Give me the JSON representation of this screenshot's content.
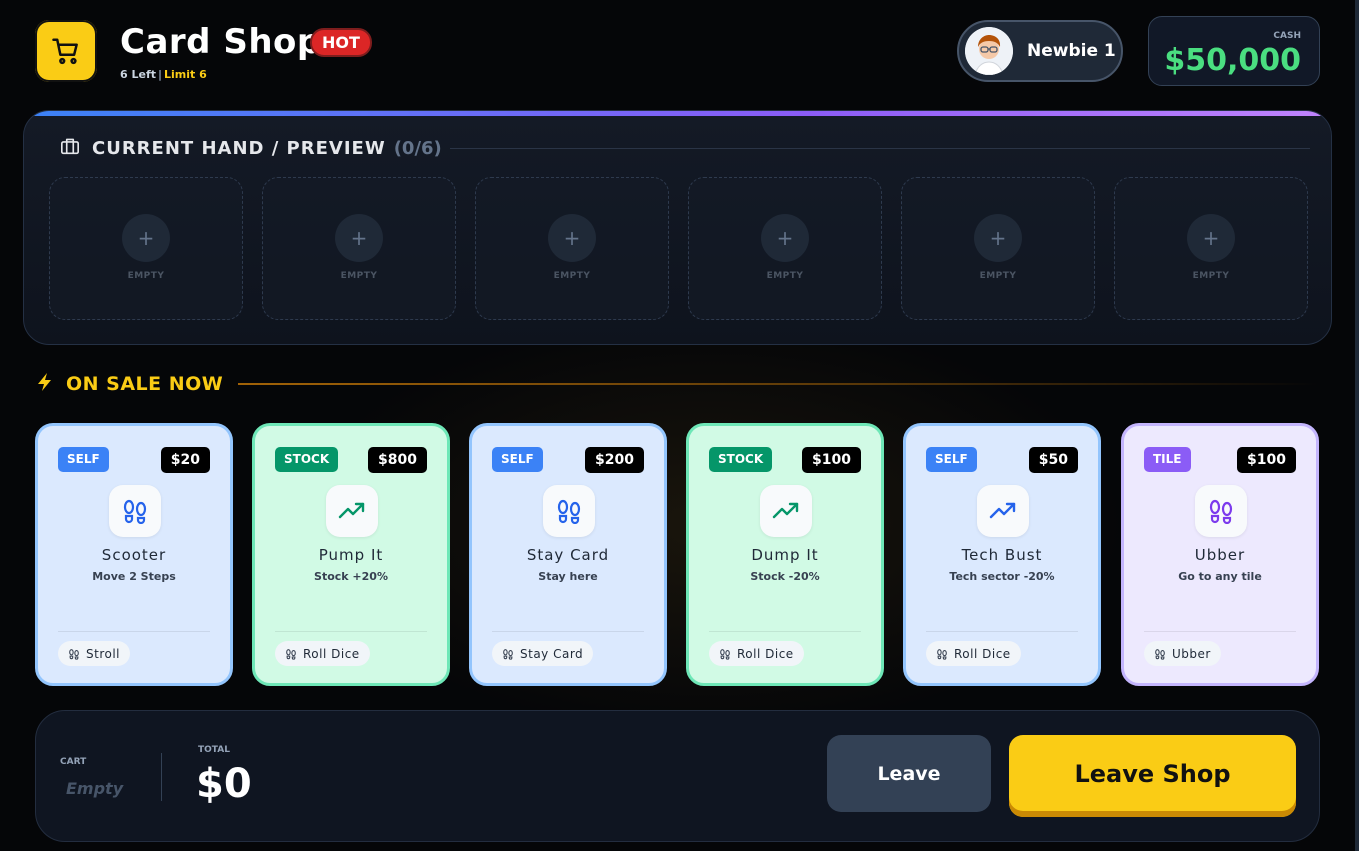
{
  "header": {
    "title": "Card Shop",
    "badge": "HOT",
    "left_text": "6 Left",
    "separator": "|",
    "limit_text": "Limit 6",
    "player_name": "Newbie 1",
    "cash_label": "CASH",
    "cash_value": "$50,000"
  },
  "hand": {
    "title": "CURRENT HAND / PREVIEW",
    "count": "(0/6)",
    "slots": [
      {
        "plus": "+",
        "label": "EMPTY"
      },
      {
        "plus": "+",
        "label": "EMPTY"
      },
      {
        "plus": "+",
        "label": "EMPTY"
      },
      {
        "plus": "+",
        "label": "EMPTY"
      },
      {
        "plus": "+",
        "label": "EMPTY"
      },
      {
        "plus": "+",
        "label": "EMPTY"
      }
    ]
  },
  "sale": {
    "title": "ON SALE NOW",
    "cards": [
      {
        "type": "self",
        "tag": "SELF",
        "price": "$20",
        "icon": "footsteps-icon",
        "name": "Scooter",
        "desc": "Move 2 Steps",
        "pill": "Stroll"
      },
      {
        "type": "stock",
        "tag": "STOCK",
        "price": "$800",
        "icon": "trending-up-icon",
        "name": "Pump It",
        "desc": "Stock +20%",
        "pill": "Roll Dice"
      },
      {
        "type": "self",
        "tag": "SELF",
        "price": "$200",
        "icon": "footsteps-icon",
        "name": "Stay Card",
        "desc": "Stay here",
        "pill": "Stay Card"
      },
      {
        "type": "stock",
        "tag": "STOCK",
        "price": "$100",
        "icon": "trending-up-icon",
        "name": "Dump It",
        "desc": "Stock -20%",
        "pill": "Roll Dice"
      },
      {
        "type": "self",
        "tag": "SELF",
        "price": "$50",
        "icon": "trending-up-icon",
        "name": "Tech Bust",
        "desc": "Tech sector -20%",
        "pill": "Roll Dice"
      },
      {
        "type": "tile",
        "tag": "TILE",
        "price": "$100",
        "icon": "footsteps-icon",
        "name": "Ubber",
        "desc": "Go to any tile",
        "pill": "Ubber"
      }
    ]
  },
  "footer": {
    "cart_label": "CART",
    "cart_value": "Empty",
    "total_label": "TOTAL",
    "total_value": "$0",
    "leave_label": "Leave",
    "leave_shop_label": "Leave Shop"
  },
  "colors": {
    "accent_yellow": "#facc15",
    "cash_green": "#4ade80",
    "hot_red": "#dc2626",
    "self_blue": "#3b82f6",
    "stock_green": "#059669",
    "tile_purple": "#8b5cf6"
  }
}
